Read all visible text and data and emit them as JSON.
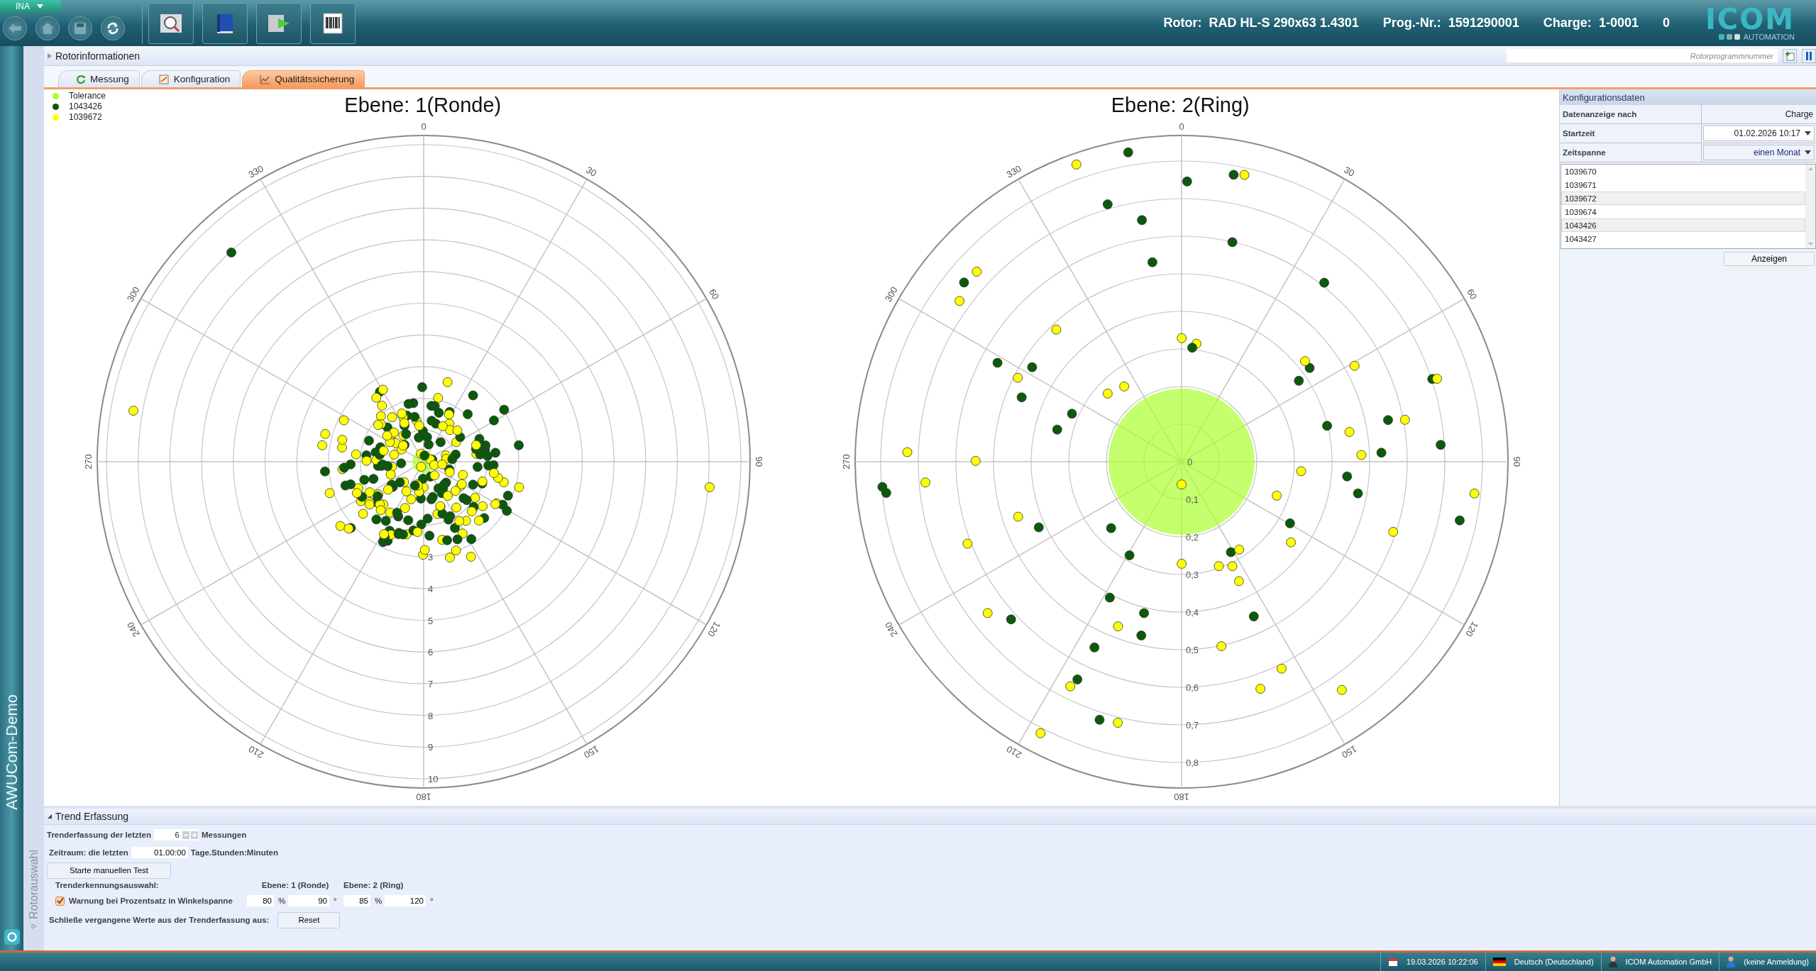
{
  "app": {
    "profile": "INA",
    "side_title": "AWUCom-Demo",
    "side_panel": "Rotorauswahl"
  },
  "header": {
    "fields": [
      {
        "label": "Rotor:",
        "value": "RAD HL-S 290x63 1.4301"
      },
      {
        "label": "Prog.-Nr.:",
        "value": "1591290001"
      },
      {
        "label": "Charge:",
        "value": "1-0001"
      }
    ],
    "counter": "0",
    "logo": {
      "name": "ICOM",
      "sub": "AUTOMATION"
    }
  },
  "info_bar": {
    "title": "Rotorinformationen",
    "expanded": false,
    "search": {
      "placeholder": "Rotorprogrammnummer"
    }
  },
  "tabs": [
    {
      "label": "Messung",
      "selected": false
    },
    {
      "label": "Konfiguration",
      "selected": false
    },
    {
      "label": "Qualitätssicherung",
      "selected": true
    }
  ],
  "legend": [
    {
      "label": "Tolerance",
      "color": "#adff2f"
    },
    {
      "label": "1043426",
      "color": "#0b5a0b"
    },
    {
      "label": "1039672",
      "color": "#ffff00"
    }
  ],
  "charts": [
    {
      "title": "Ebene: 1(Ronde)",
      "angle_labels": [
        "0",
        "30",
        "60",
        "90",
        "120",
        "150",
        "180",
        "210",
        "240",
        "270",
        "300",
        "330"
      ],
      "ring_labels": [
        "3",
        "4",
        "5",
        "6",
        "7",
        "8",
        "9",
        "10"
      ]
    },
    {
      "title": "Ebene: 2(Ring)",
      "angle_labels": [
        "0",
        "30",
        "60",
        "90",
        "120",
        "150",
        "180",
        "210",
        "240",
        "270",
        "300",
        "330"
      ],
      "center_label": "0",
      "ring_labels": [
        "0,1",
        "0,2",
        "0,3",
        "0,4",
        "0,5",
        "0,6",
        "0,7",
        "0,8"
      ]
    }
  ],
  "config": {
    "title": "Konfigurationsdaten",
    "rows": [
      {
        "kind": "text",
        "label": "Datenanzeige nach",
        "value": "Charge"
      },
      {
        "kind": "date",
        "label": "Startzeit",
        "value": "01.02.2026 10:17"
      },
      {
        "kind": "dropdown",
        "label": "Zeitspanne",
        "value": "einen Monat"
      }
    ],
    "items": [
      {
        "label": "1039670",
        "selected": false
      },
      {
        "label": "1039671",
        "selected": false
      },
      {
        "label": "1039672",
        "selected": true
      },
      {
        "label": "1039674",
        "selected": false
      },
      {
        "label": "1043426",
        "selected": true
      },
      {
        "label": "1043427",
        "selected": false
      }
    ],
    "button": "Anzeigen"
  },
  "trend": {
    "title": "Trend Erfassung",
    "expanded": true,
    "count": {
      "label": "Trenderfassung der letzten",
      "value": "6",
      "unit": "Messungen"
    },
    "period": {
      "label": "Zeitraum: die letzten",
      "value": "01.00:00",
      "unit": "Tage.Stunden:Minuten"
    },
    "test_button": "Starte manuellen Test",
    "selection_label": "Trenderkennungsauswahl:",
    "level_headers": [
      "Ebene: 1 (Ronde)",
      "Ebene: 2 (Ring)"
    ],
    "warning": {
      "label": "Warnung bei Prozentsatz in Winkelspanne",
      "checked": true,
      "fields": [
        {
          "value": "80",
          "unit": "%"
        },
        {
          "value": "90",
          "unit": "°"
        },
        {
          "value": "85",
          "unit": "%"
        },
        {
          "value": "120",
          "unit": "°"
        }
      ]
    },
    "reset": {
      "label": "Schließe vergangene Werte aus der Trenderfassung aus:",
      "button": "Reset"
    }
  },
  "status_bar": [
    {
      "kind": "calendar",
      "label": "19.03.2026 10:22:06"
    },
    {
      "kind": "flag",
      "label": "Deutsch (Deutschland)"
    },
    {
      "kind": "company",
      "label": "ICOM Automation GmbH"
    },
    {
      "kind": "user",
      "label": "(keine Anmeldung)"
    }
  ]
}
